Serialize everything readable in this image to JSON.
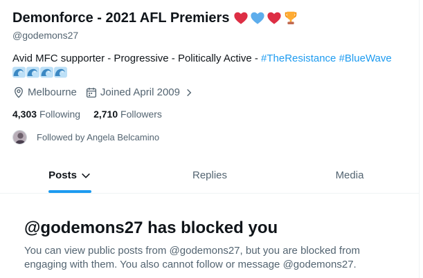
{
  "profile": {
    "display_name": "Demonforce - 2021 AFL Premiers",
    "name_emojis": [
      "red-heart",
      "blue-heart",
      "red-heart",
      "trophy"
    ],
    "handle": "@godemons27",
    "bio_text": "Avid MFC supporter - Progressive - Politically Active - ",
    "hashtags": [
      "#TheResistance",
      "#BlueWave"
    ],
    "bio_emojis": [
      "water-wave",
      "water-wave",
      "water-wave",
      "water-wave"
    ],
    "location": "Melbourne",
    "joined": "Joined April 2009",
    "following_count": "4,303",
    "following_label": "Following",
    "followers_count": "2,710",
    "followers_label": "Followers",
    "followed_by": "Followed by Angela Belcamino"
  },
  "tabs": [
    {
      "label": "Posts",
      "active": true
    },
    {
      "label": "Replies",
      "active": false
    },
    {
      "label": "Media",
      "active": false
    }
  ],
  "blocked": {
    "title": "@godemons27 has blocked you",
    "message": "You can view public posts from @godemons27, but you are blocked from engaging with them. You also cannot follow or message @godemons27."
  },
  "colors": {
    "accent": "#1d9bf0",
    "secondary_text": "#536471",
    "primary_text": "#0f1419"
  }
}
